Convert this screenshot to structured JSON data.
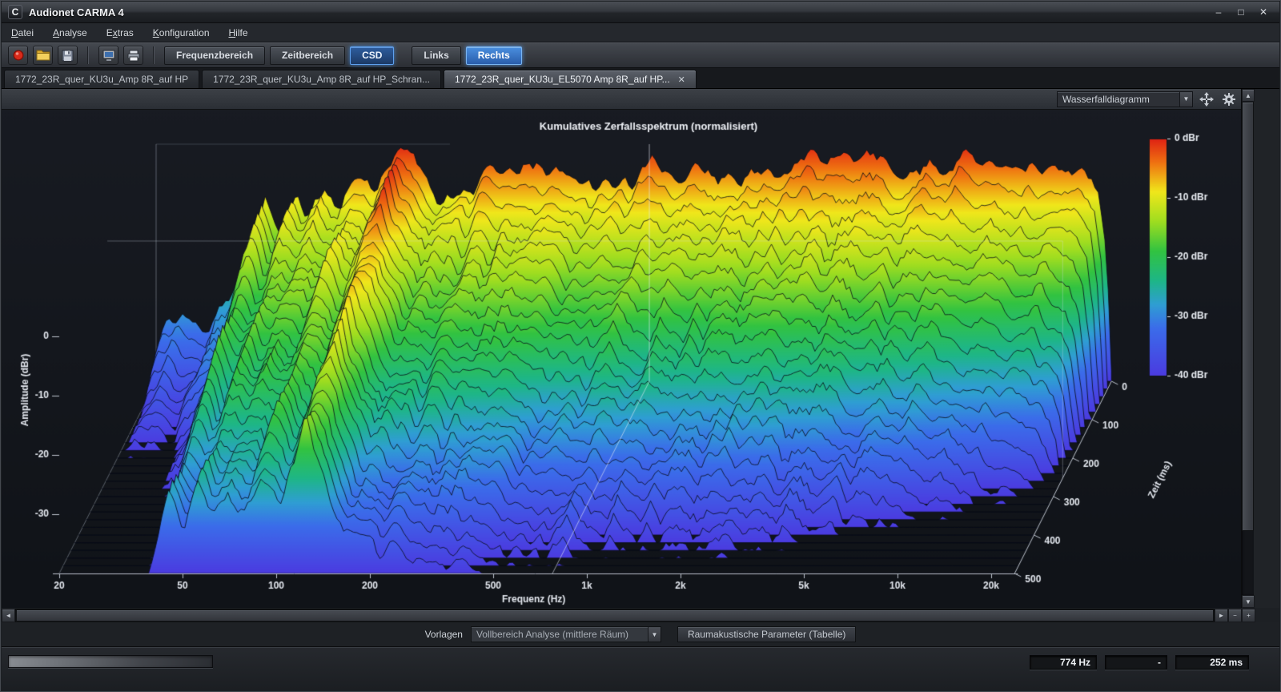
{
  "window": {
    "title": "Audionet CARMA 4",
    "icon_letter": "C",
    "controls": {
      "minimize": "–",
      "maximize": "□",
      "close": "✕"
    }
  },
  "menu": {
    "items": [
      {
        "label": "Datei",
        "underline_index": 0
      },
      {
        "label": "Analyse",
        "underline_index": 0
      },
      {
        "label": "Extras",
        "underline_index": 1
      },
      {
        "label": "Konfiguration",
        "underline_index": 0
      },
      {
        "label": "Hilfe",
        "underline_index": 0
      }
    ]
  },
  "toolbar": {
    "icon_buttons": [
      {
        "name": "record-icon"
      },
      {
        "name": "open-folder-icon"
      },
      {
        "name": "save-icon"
      },
      {
        "name": "screenshot-icon"
      },
      {
        "name": "print-icon"
      }
    ],
    "view_buttons": [
      {
        "label": "Frequenzbereich",
        "active": false
      },
      {
        "label": "Zeitbereich",
        "active": false
      },
      {
        "label": "CSD",
        "active": true
      }
    ],
    "channel_buttons": [
      {
        "label": "Links",
        "active": false
      },
      {
        "label": "Rechts",
        "active": true
      }
    ]
  },
  "tabs": [
    {
      "label": "1772_23R_quer_KU3u_Amp 8R_auf HP",
      "active": false
    },
    {
      "label": "1772_23R_quer_KU3u_Amp 8R_auf HP_Schran...",
      "active": false
    },
    {
      "label": "1772_23R_quer_KU3u_EL5070 Amp 8R_auf HP...",
      "active": true,
      "close_glyph": "✕"
    }
  ],
  "view_controls": {
    "diagram_dropdown_value": "Wasserfalldiagramm",
    "dropdown_chevron": "▼"
  },
  "chart_data": {
    "type": "waterfall_csd",
    "title": "Kumulatives Zerfallsspektrum (normalisiert)",
    "xlabel": "Frequenz (Hz)",
    "ylabel": "Amplitude (dBr)",
    "zlabel": "Zeit (ms)",
    "x_scale": "log",
    "x_range_hz": [
      20,
      23800
    ],
    "x_ticks": [
      "20",
      "50",
      "100",
      "200",
      "500",
      "1k",
      "2k",
      "5k",
      "10k",
      "20k"
    ],
    "x_tick_hz": [
      20,
      50,
      100,
      200,
      500,
      1000,
      2000,
      5000,
      10000,
      20000
    ],
    "y_range_dbr": [
      -40,
      0
    ],
    "y_ticks_dbr": [
      0,
      -10,
      -20,
      -30
    ],
    "z_range_ms": [
      0,
      500
    ],
    "z_ticks_ms": [
      0,
      100,
      200,
      300,
      400,
      500
    ],
    "num_slices": 26,
    "cursor": {
      "frequency_hz": 774,
      "time_ms": 252
    },
    "colorbar": {
      "labels": [
        "0 dBr",
        "-10 dBr",
        "-20 dBr",
        "-30 dBr",
        "-40 dBr"
      ],
      "stops": [
        {
          "dbr": 0,
          "color": "#df2114"
        },
        {
          "dbr": -4,
          "color": "#ef7011"
        },
        {
          "dbr": -9,
          "color": "#f0e71b"
        },
        {
          "dbr": -14,
          "color": "#9fdd20"
        },
        {
          "dbr": -19,
          "color": "#32c341"
        },
        {
          "dbr": -24,
          "color": "#1eb687"
        },
        {
          "dbr": -28,
          "color": "#2f9ed3"
        },
        {
          "dbr": -32,
          "color": "#3b6cea"
        },
        {
          "dbr": -40,
          "color": "#4b3be0"
        }
      ]
    },
    "spectrum_t0": {
      "freq_hz": [
        20,
        24,
        28,
        34,
        40,
        45,
        50,
        56,
        63,
        70,
        78,
        88,
        100,
        112,
        125,
        135,
        150,
        165,
        185,
        210,
        240,
        270,
        310,
        360,
        420,
        500,
        580,
        680,
        800,
        950,
        1100,
        1300,
        1550,
        1850,
        2200,
        2700,
        3300,
        4000,
        5000,
        6000,
        7000,
        8500,
        10000,
        12000,
        14000,
        16500,
        19000,
        21500,
        23000,
        23800
      ],
      "dbr": [
        -33,
        -29,
        -32,
        -26,
        -18,
        -10,
        -14,
        -8,
        -12,
        -7,
        -11,
        -6,
        -9,
        -5,
        -0.5,
        -2,
        -7,
        -10,
        -6,
        -8.5,
        -5,
        -7,
        -4,
        -6,
        -4.5,
        -6.5,
        -4.5,
        -6,
        -4.5,
        -6,
        -4.5,
        -6,
        -4.5,
        -5.5,
        -3.5,
        -2.5,
        -4,
        -2.5,
        -4.5,
        -3,
        -4.5,
        -2.5,
        -4,
        -3,
        -4.5,
        -3,
        -4.5,
        -7,
        -20,
        -36
      ]
    },
    "decay_db_per_ms": {
      "freq_hz": [
        20,
        30,
        42,
        56,
        70,
        88,
        105,
        125,
        150,
        185,
        230,
        300,
        400,
        550,
        800,
        1200,
        2000,
        3000,
        4500,
        6500,
        9000,
        12500,
        17000,
        23000
      ],
      "rate": [
        0.052,
        0.048,
        0.04,
        0.034,
        0.038,
        0.033,
        0.04,
        0.03,
        0.045,
        0.052,
        0.06,
        0.065,
        0.068,
        0.072,
        0.075,
        0.078,
        0.08,
        0.085,
        0.088,
        0.092,
        0.098,
        0.105,
        0.115,
        0.13
      ]
    },
    "colors": {
      "plot_bg": "#14171d",
      "axis": "#bcc2cc",
      "slice_outline": "#081018",
      "cursor": "#dfe6f2"
    }
  },
  "scrollbars": {
    "up": "▲",
    "down": "▼",
    "left": "◄",
    "right": "►",
    "zoom_out": "−",
    "zoom_in": "+"
  },
  "footer": {
    "vorlagen_label": "Vorlagen",
    "template_dropdown_value": "Vollbereich Analyse (mittlere Räum)",
    "dropdown_chevron": "▼",
    "parameter_button_label": "Raumakustische Parameter (Tabelle)"
  },
  "statusbar": {
    "frequency": "774 Hz",
    "middle": "-",
    "time": "252 ms"
  }
}
